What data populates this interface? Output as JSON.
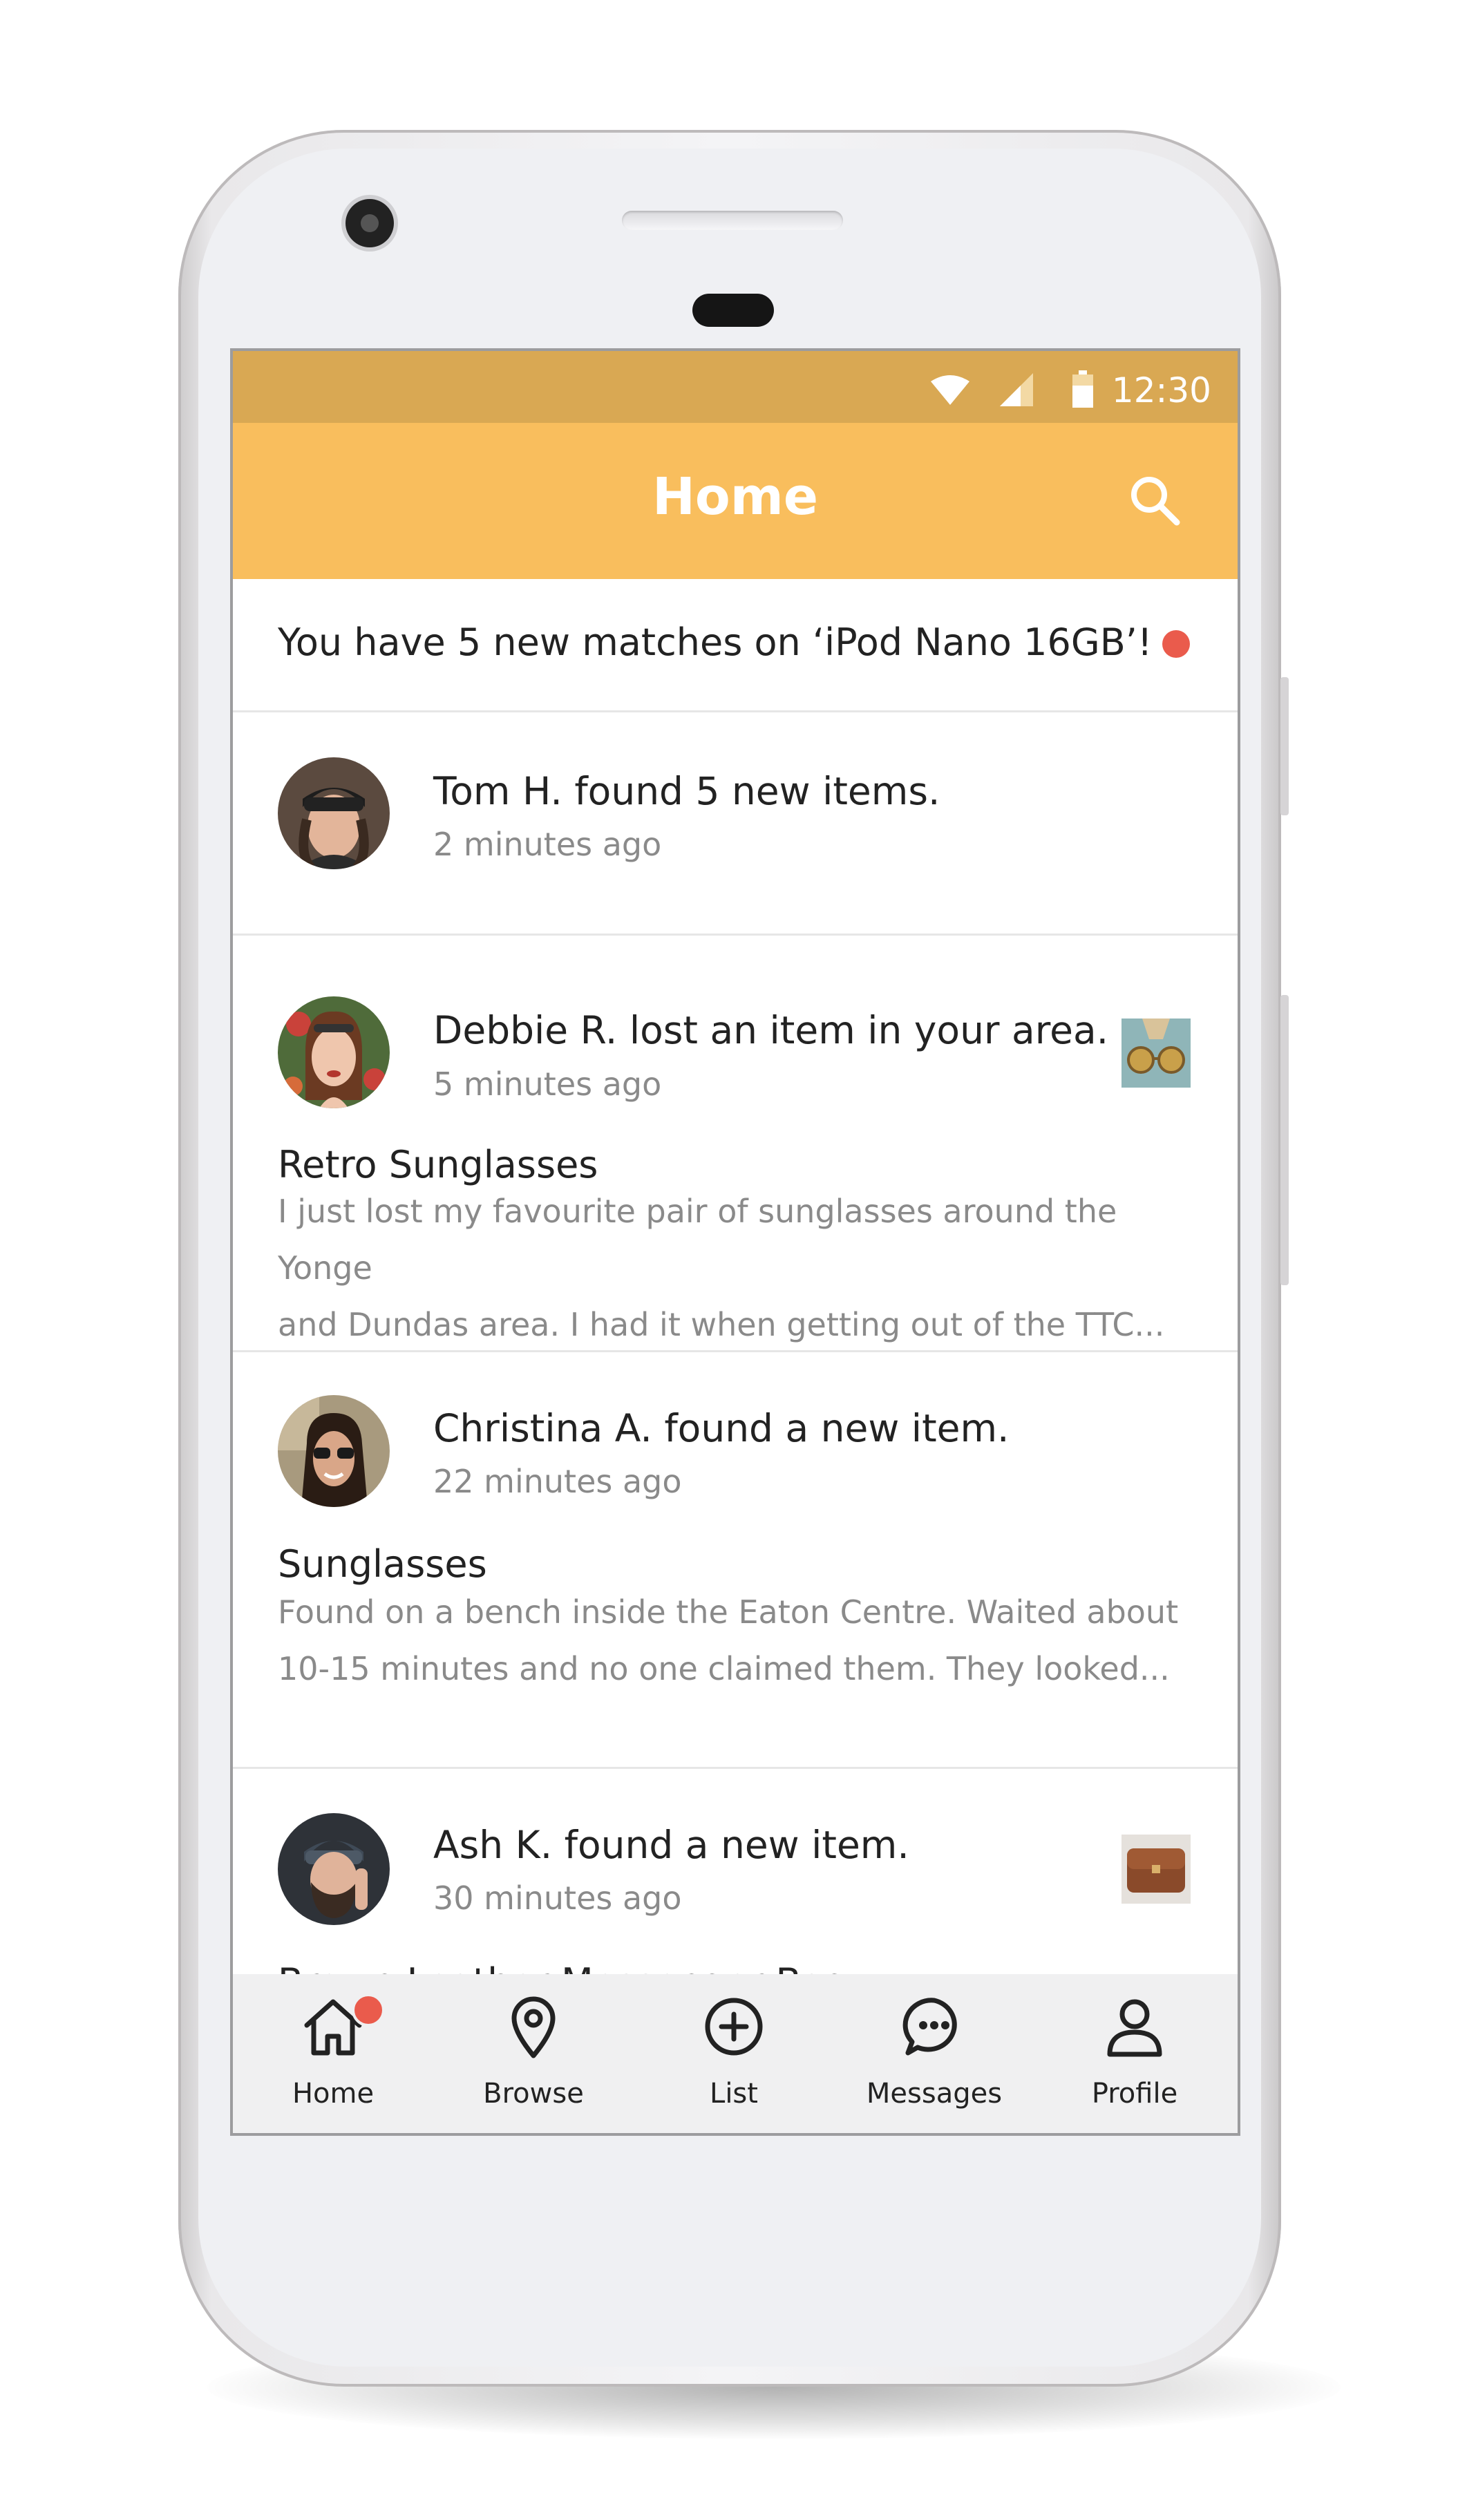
{
  "status_bar": {
    "time": "12:30"
  },
  "app_bar": {
    "title": "Home"
  },
  "banner": {
    "text": "You have 5 new matches on ‘iPod Nano 16GB’!"
  },
  "feed": [
    {
      "name_text": "Tom H. found 5 new items.",
      "time": "2 minutes ago",
      "avatar": "man-with-cap-avatar"
    },
    {
      "name_text": "Debbie R. lost an item in your area.",
      "time": "5 minutes ago",
      "avatar": "woman-with-sunglasses-on-head-avatar",
      "thumbnail": "sunglasses-thumbnail",
      "item_title": "Retro Sunglasses",
      "item_desc_line1": "I just lost my favourite pair of sunglasses around the Yonge",
      "item_desc_line2": "and Dundas area. I had it when getting out of the TTC..."
    },
    {
      "name_text": "Christina A. found a new item.",
      "time": "22 minutes ago",
      "avatar": "woman-with-sunglasses-avatar",
      "item_title": "Sunglasses",
      "item_desc_line1": "Found on a bench inside the Eaton Centre. Waited about",
      "item_desc_line2": "10-15 minutes and no one claimed them. They looked..."
    },
    {
      "name_text": "Ash K. found a new item.",
      "time": "30 minutes ago",
      "avatar": "bearded-man-avatar",
      "thumbnail": "leather-bag-thumbnail",
      "item_title": "Brown Leather Messenger Bag"
    }
  ],
  "bottom_nav": [
    {
      "label": "Home",
      "icon": "home-icon",
      "has_badge": true
    },
    {
      "label": "Browse",
      "icon": "map-pin-icon"
    },
    {
      "label": "List",
      "icon": "plus-circle-icon"
    },
    {
      "label": "Messages",
      "icon": "chat-bubble-icon"
    },
    {
      "label": "Profile",
      "icon": "person-icon"
    }
  ],
  "colors": {
    "status_bar": "#d9a853",
    "app_bar": "#f9be5d",
    "notification_dot": "#ea5b4c",
    "nav_background": "#f0f0f1"
  }
}
